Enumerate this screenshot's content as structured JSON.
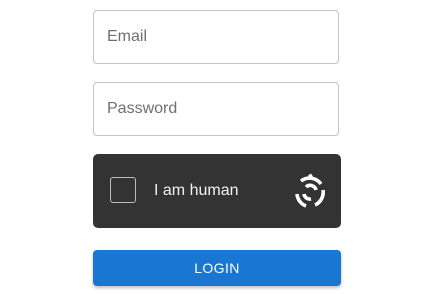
{
  "form": {
    "email": {
      "value": "",
      "placeholder": "Email"
    },
    "password": {
      "value": "",
      "placeholder": "Password"
    },
    "captcha": {
      "label": "I am human",
      "checked": false,
      "logo_icon": "hcaptcha-logo-icon",
      "background_color": "#333333"
    },
    "login_button": {
      "label": "LOGIN",
      "color": "#1976d2"
    }
  }
}
